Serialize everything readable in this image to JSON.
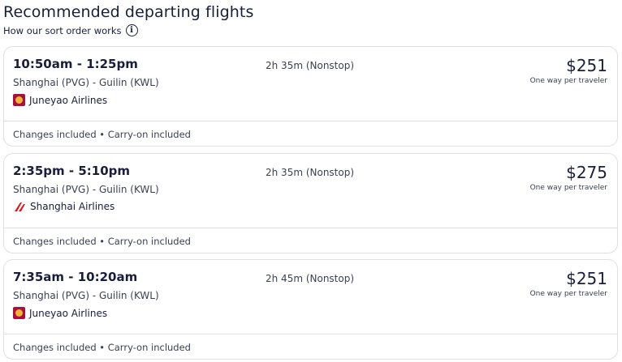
{
  "header": {
    "title": "Recommended departing flights",
    "sort_link": "How our sort order works",
    "info_glyph": "i"
  },
  "flights": [
    {
      "times": "10:50am - 1:25pm",
      "route": "Shanghai (PVG) - Guilin (KWL)",
      "airline": "Juneyao Airlines",
      "airline_icon": "juneyao-logo-icon",
      "duration": "2h 35m (Nonstop)",
      "price": "$251",
      "price_note": "One way per traveler",
      "perks": "Changes included • Carry-on included"
    },
    {
      "times": "2:35pm - 5:10pm",
      "route": "Shanghai (PVG) - Guilin (KWL)",
      "airline": "Shanghai Airlines",
      "airline_icon": "shanghai-airlines-logo-icon",
      "duration": "2h 35m (Nonstop)",
      "price": "$275",
      "price_note": "One way per traveler",
      "perks": "Changes included • Carry-on included"
    },
    {
      "times": "7:35am - 10:20am",
      "route": "Shanghai (PVG) - Guilin (KWL)",
      "airline": "Juneyao Airlines",
      "airline_icon": "juneyao-logo-icon",
      "duration": "2h 45m (Nonstop)",
      "price": "$251",
      "price_note": "One way per traveler",
      "perks": "Changes included • Carry-on included"
    }
  ],
  "colors": {
    "text": "#191e3b",
    "border": "#dfe0e4",
    "juneyao": "#a8113a",
    "shanghai": "#d71920"
  }
}
